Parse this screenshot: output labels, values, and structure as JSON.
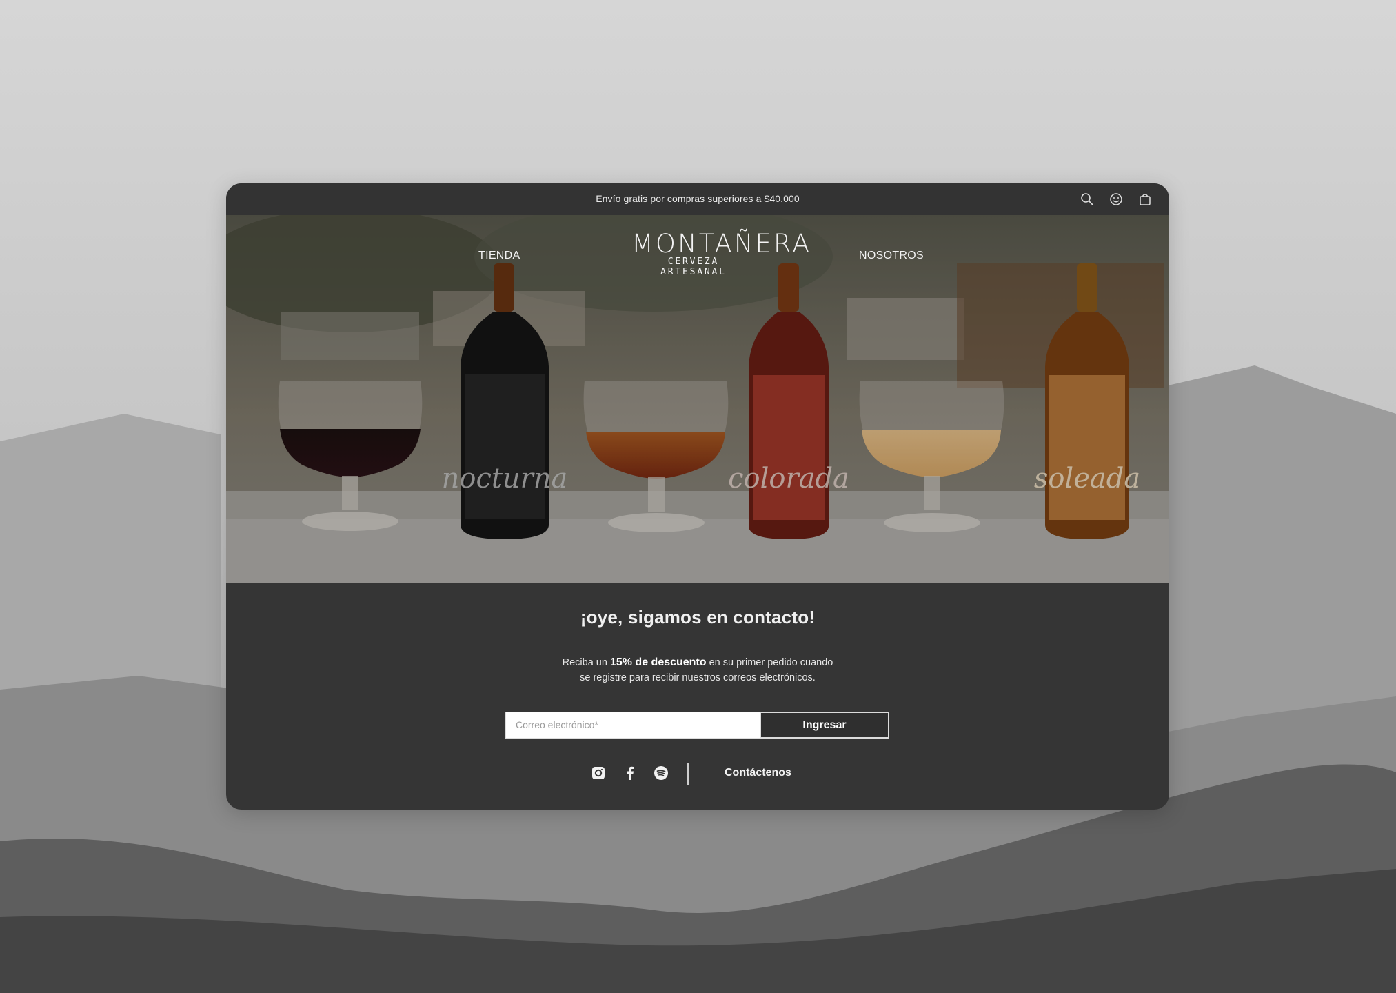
{
  "topbar": {
    "announcement": "Envío gratis por compras superiores a $40.000",
    "icons": [
      "search-icon",
      "account-icon",
      "bag-icon"
    ]
  },
  "nav": {
    "left_link": "TIENDA",
    "right_link": "NOSOTROS"
  },
  "brand": {
    "name": "MONTAÑERA",
    "tagline": "CERVEZA ARTESANAL"
  },
  "hero": {
    "bottle_labels": [
      "nocturna",
      "colorada",
      "soleada"
    ],
    "bottle_brand": "MONTAÑERA"
  },
  "newsletter": {
    "headline": "¡oye, sigamos en contacto!",
    "desc_prefix": "Reciba un ",
    "desc_highlight": "15% de descuento",
    "desc_suffix": " en su primer pedido cuando",
    "desc_line2": "se registre para recibir nuestros correos electrónicos.",
    "email_placeholder": "Correo electrónico*",
    "submit_label": "Ingresar"
  },
  "footer": {
    "social_icons": [
      "instagram-icon",
      "facebook-icon",
      "spotify-icon"
    ],
    "contact_label": "Contáctenos"
  },
  "colors": {
    "card_bg": "#353535",
    "text": "#f0f0f0",
    "button_border": "#dcdcdc"
  }
}
